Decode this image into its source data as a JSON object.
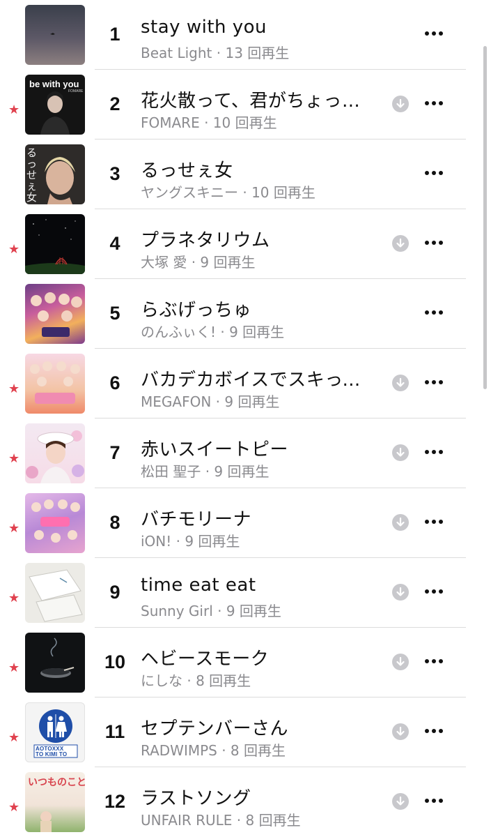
{
  "tracks": [
    {
      "rank": "1",
      "title": "stay with you",
      "subtitle": "Beat Light · 13 回再生",
      "starred": false,
      "downloaded": false
    },
    {
      "rank": "2",
      "title": "花火散って、君がちょっと寂しくなって",
      "subtitle": "FOMARE · 10 回再生",
      "starred": true,
      "downloaded": true
    },
    {
      "rank": "3",
      "title": "るっせぇ女",
      "subtitle": "ヤングスキニー · 10 回再生",
      "starred": false,
      "downloaded": false
    },
    {
      "rank": "4",
      "title": "プラネタリウム",
      "subtitle": "大塚 愛 · 9 回再生",
      "starred": true,
      "downloaded": true
    },
    {
      "rank": "5",
      "title": "らぶげっちゅ",
      "subtitle": "のんふぃく! · 9 回再生",
      "starred": false,
      "downloaded": false
    },
    {
      "rank": "6",
      "title": "バカデカボイスでスキって言って",
      "subtitle": "MEGAFON · 9 回再生",
      "starred": true,
      "downloaded": true
    },
    {
      "rank": "7",
      "title": "赤いスイートピー",
      "subtitle": "松田 聖子 · 9 回再生",
      "starred": true,
      "downloaded": true
    },
    {
      "rank": "8",
      "title": "バチモリーナ",
      "subtitle": "iON! · 9 回再生",
      "starred": true,
      "downloaded": true
    },
    {
      "rank": "9",
      "title": "time eat eat",
      "subtitle": "Sunny Girl · 9 回再生",
      "starred": true,
      "downloaded": true
    },
    {
      "rank": "10",
      "title": "ヘビースモーク",
      "subtitle": "にしな · 8 回再生",
      "starred": true,
      "downloaded": true
    },
    {
      "rank": "11",
      "title": "セプテンバーさん",
      "subtitle": "RADWIMPS · 8 回再生",
      "starred": true,
      "downloaded": true
    },
    {
      "rank": "12",
      "title": "ラストソング",
      "subtitle": "UNFAIR RULE · 8 回再生",
      "starred": true,
      "downloaded": true
    }
  ],
  "artwork_text": {
    "be_with_you": "be with you",
    "be_with_you_small": "FOMARE",
    "yangskinny": "るっせぇ女",
    "aotoxxx_line1": "AOTOXXX",
    "aotoxxx_line2": "TO KIMI TO",
    "itsumo": "いつものこと"
  },
  "icons": {
    "star": "star-icon",
    "download": "download-icon",
    "more": "more-icon"
  },
  "colors": {
    "star": "#e0414e",
    "secondary_text": "#8a8a8e",
    "download_circle": "#c8c8cc"
  }
}
